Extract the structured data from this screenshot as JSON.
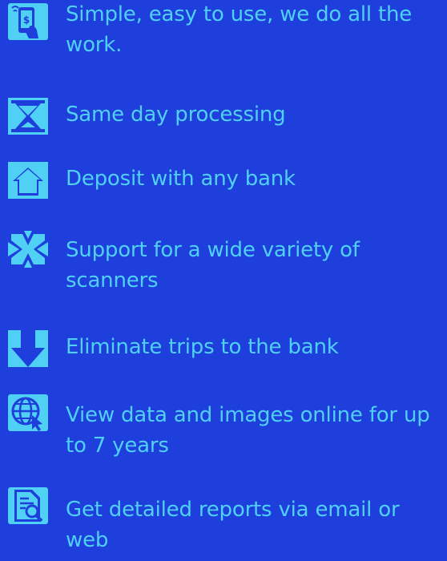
{
  "colors": {
    "background": "#1e3fdc",
    "accent": "#4fd0f4"
  },
  "features": [
    {
      "icon": "mobile-deposit-icon",
      "label": "Simple, easy to use, we do all the work."
    },
    {
      "icon": "hourglass-icon",
      "label": "Same day processing"
    },
    {
      "icon": "home-icon",
      "label": "Deposit with any bank"
    },
    {
      "icon": "scanner-arrows-icon",
      "label": "Support for a wide variety of scanners"
    },
    {
      "icon": "down-arrow-icon",
      "label": "Eliminate trips to the bank"
    },
    {
      "icon": "globe-cursor-icon",
      "label": "View data and images online for up to 7 years"
    },
    {
      "icon": "report-search-icon",
      "label": "Get detailed reports via email or web"
    }
  ]
}
